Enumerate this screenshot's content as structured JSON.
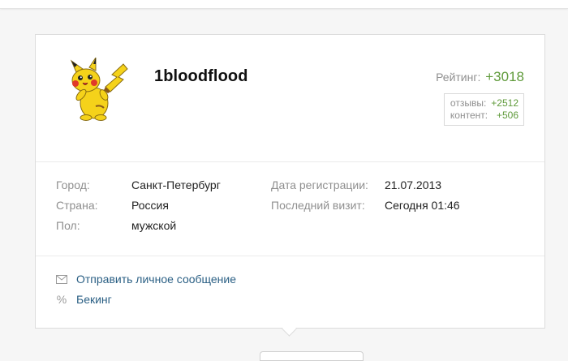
{
  "profile": {
    "username": "1bloodflood",
    "rating_label": "Рейтинг:",
    "rating_value": "+3018",
    "reviews_label": "отзывы:",
    "reviews_value": "+2512",
    "content_label": "контент:",
    "content_value": "+506",
    "avatar_icon": "pikachu-avatar"
  },
  "details": {
    "city_label": "Город:",
    "city_value": "Санкт-Петербург",
    "country_label": "Страна:",
    "country_value": "Россия",
    "gender_label": "Пол:",
    "gender_value": "мужской",
    "registered_label": "Дата регистрации:",
    "registered_value": "21.07.2013",
    "last_visit_label": "Последний визит:",
    "last_visit_value": "Сегодня 01:46"
  },
  "actions": {
    "message_label": "Отправить личное сообщение",
    "message_icon": "envelope-icon",
    "backing_label": "Бекинг",
    "backing_icon": "percent-icon"
  },
  "colors": {
    "link": "#2a5f84",
    "rating_green": "#5f9a3a",
    "muted": "#8f8f8f"
  }
}
